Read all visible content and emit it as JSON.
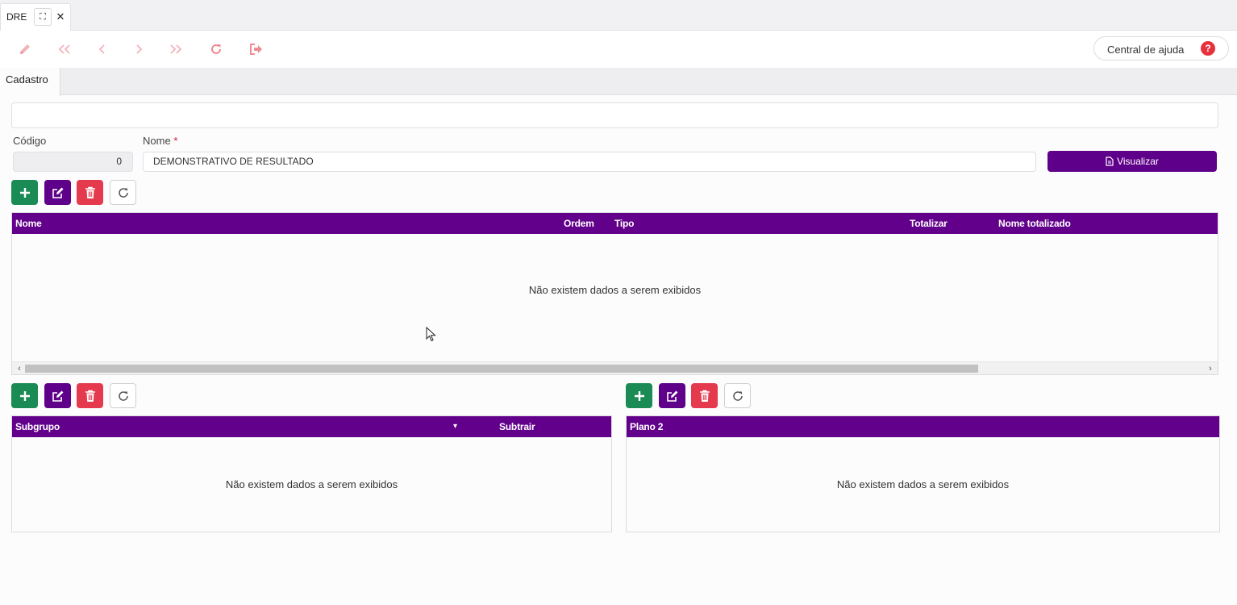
{
  "window": {
    "tab_label": "DRE",
    "maximize_glyph": "⛶",
    "close_glyph": "✕"
  },
  "toolbar": {
    "icons": [
      "pencil-icon",
      "first-icon",
      "prev-icon",
      "next-icon",
      "last-icon",
      "refresh-icon",
      "exit-icon"
    ],
    "help_label": "Central de ajuda",
    "help_glyph": "?",
    "icon_color": "#f2b3b8"
  },
  "section": {
    "tab_label": "Cadastro"
  },
  "form": {
    "codigo_label": "Código",
    "codigo_value": "0",
    "nome_label": "Nome",
    "nome_required": "*",
    "nome_value": "DEMONSTRATIVO DE RESULTADO",
    "visualizar_label": "Visualizar"
  },
  "main_grid": {
    "columns": [
      "Nome",
      "Ordem",
      "Tipo",
      "Totalizar",
      "Nome totalizado"
    ],
    "empty_text": "Não existem dados a serem exibidos",
    "scroll_left": "‹",
    "scroll_right": "›"
  },
  "subgroup_grid": {
    "columns": [
      "Subgrupo",
      "Subtrair"
    ],
    "sort_glyph": "▾",
    "empty_text": "Não existem dados a serem exibidos"
  },
  "plano_grid": {
    "columns": [
      "Plano 2"
    ],
    "empty_text": "Não existem dados a serem exibidos"
  },
  "colors": {
    "header_purple": "#62008c",
    "add_green": "#1b8b56",
    "delete_red": "#e5394d"
  }
}
